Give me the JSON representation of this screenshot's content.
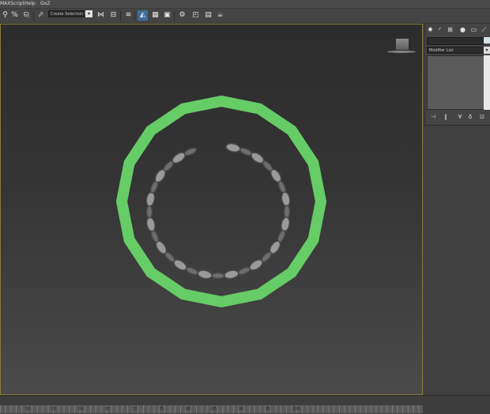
{
  "menu": {
    "items": [
      "MAXScript",
      "Help",
      "GoZ"
    ]
  },
  "toolbar": {
    "selection_set_placeholder": "Create Selection Se",
    "dropdown_arrow": "▾",
    "icons": [
      "link-icon",
      "unlink-icon",
      "bind-spacewarp-icon",
      "selection-filter-icon",
      "mirror-icon",
      "align-icon",
      "layer-manager-icon",
      "curve-editor-icon",
      "schematic-view-icon",
      "material-editor-icon",
      "render-setup-icon",
      "rendered-frame-icon",
      "render-icon",
      "teapot-icon"
    ]
  },
  "viewport": {
    "circle_color": "#66cc66",
    "chain_color": "#9a9a9a"
  },
  "command_panel": {
    "tab_icons": [
      "create-icon",
      "modify-icon",
      "hierarchy-icon",
      "motion-icon",
      "display-icon",
      "utilities-icon"
    ],
    "modifier_list_label": "Modifier List",
    "modifier_arrow": "▾",
    "stack_buttons": [
      "pin-stack-icon",
      "show-end-result-icon",
      "make-unique-icon",
      "remove-modifier-icon",
      "configure-sets-icon"
    ]
  },
  "timeline": {
    "ticks": [
      "50",
      "55",
      "60",
      "65",
      "70",
      "75",
      "80",
      "85",
      "90",
      "95",
      "100"
    ]
  },
  "colors": {
    "accent_blue": "#3d6e9c",
    "viewport_border": "#8a7a3a",
    "background": "#444444"
  }
}
